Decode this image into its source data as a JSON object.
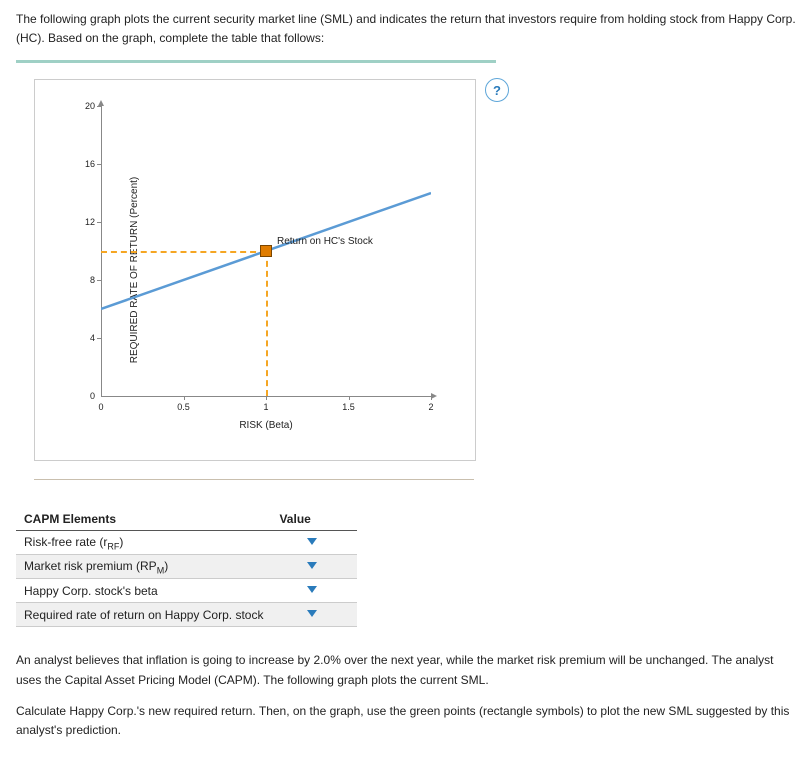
{
  "intro_p1": "The following graph plots the current security market line (SML) and indicates the return that investors require from holding stock from Happy Corp. (HC). Based on the graph, complete the table that follows:",
  "help_label": "?",
  "chart_data": {
    "type": "line",
    "xlabel": "RISK (Beta)",
    "ylabel": "REQUIRED RATE OF RETURN (Percent)",
    "xlim": [
      0,
      2.0
    ],
    "ylim": [
      0,
      20.0
    ],
    "xticks": [
      0,
      0.5,
      1.0,
      1.5,
      2.0
    ],
    "yticks": [
      0,
      4.0,
      8.0,
      12.0,
      16.0,
      20.0
    ],
    "series": [
      {
        "name": "Security Market Line",
        "x": [
          0,
          2.0
        ],
        "y": [
          6.0,
          14.0
        ],
        "color": "#5b9bd5"
      }
    ],
    "highlight": {
      "label": "Return on HC's Stock",
      "beta": 1.0,
      "required_return": 10.0
    }
  },
  "table": {
    "header_elem": "CAPM Elements",
    "header_val": "Value",
    "rows": [
      {
        "label_html": "Risk-free rate (r<sub>RF</sub>)"
      },
      {
        "label_html": "Market risk premium (RP<sub>M</sub>)"
      },
      {
        "label_html": "Happy Corp. stock's beta"
      },
      {
        "label_html": "Required rate of return on Happy Corp. stock"
      }
    ]
  },
  "followup_p1": "An analyst believes that inflation is going to increase by 2.0% over the next year, while the market risk premium will be unchanged. The analyst uses the Capital Asset Pricing Model (CAPM). The following graph plots the current SML.",
  "followup_p2": "Calculate Happy Corp.'s new required return. Then, on the graph, use the green points (rectangle symbols) to plot the new SML suggested by this analyst's prediction."
}
